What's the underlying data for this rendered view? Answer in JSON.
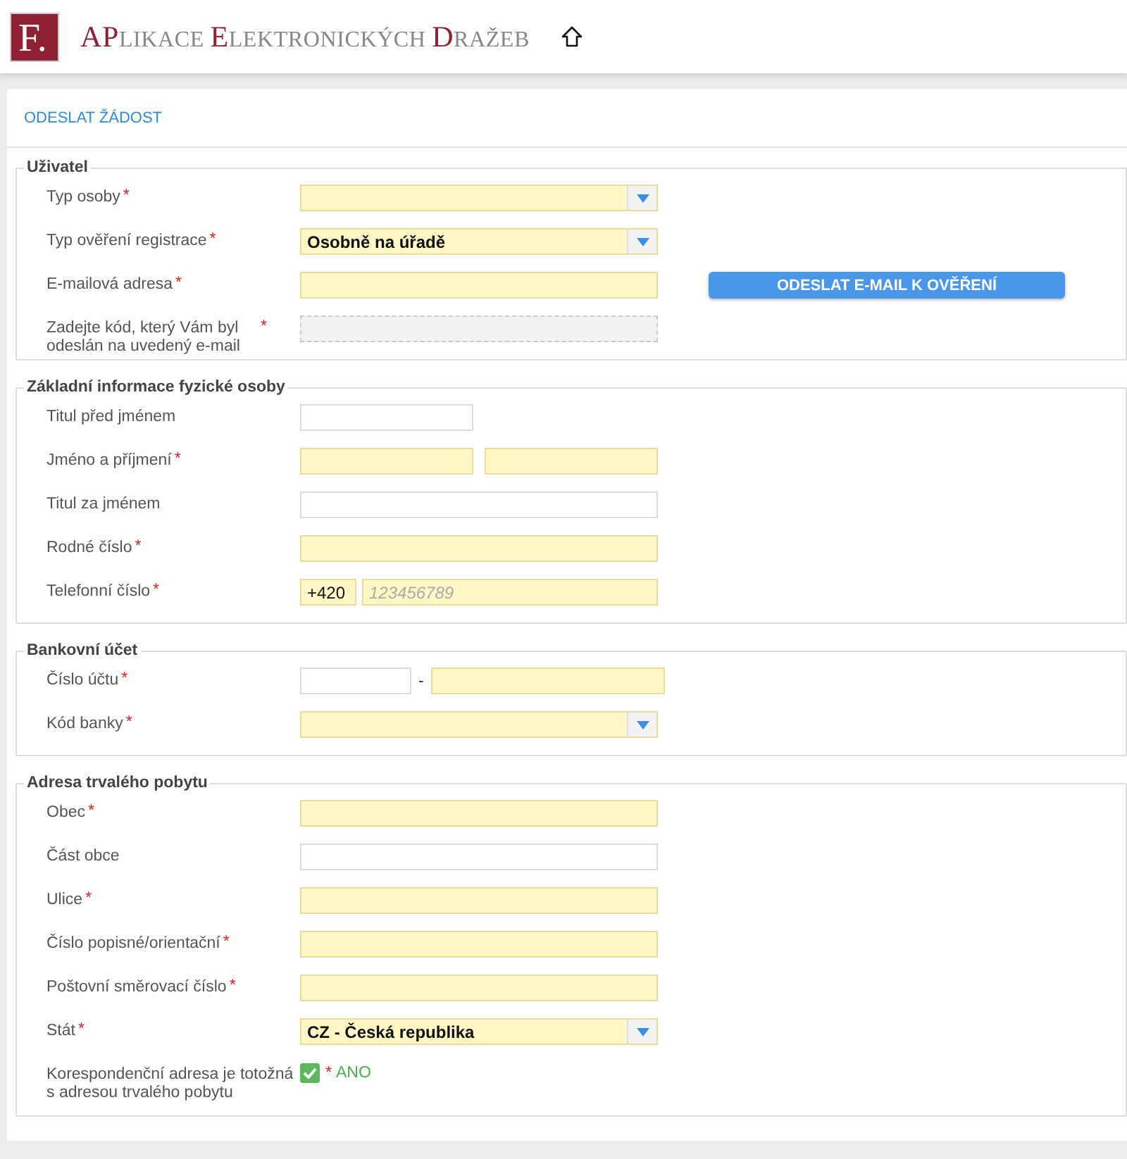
{
  "header": {
    "logo": "F.",
    "title": [
      {
        "text": "AP",
        "accent": true,
        "big": true
      },
      {
        "text": "LIKACE ",
        "accent": false,
        "big": false
      },
      {
        "text": "E",
        "accent": true,
        "big": true
      },
      {
        "text": "LEKTRONICKÝCH ",
        "accent": false,
        "big": false
      },
      {
        "text": "D",
        "accent": true,
        "big": true
      },
      {
        "text": "RAŽEB",
        "accent": false,
        "big": false
      }
    ]
  },
  "card": {
    "title": "ODESLAT ŽÁDOST"
  },
  "sections": [
    {
      "legend": "Uživatel",
      "rows": [
        {
          "kind": "select",
          "label": "Typ osoby",
          "mark": "*"
        },
        {
          "kind": "select",
          "label": "Typ ověření registrace",
          "mark": "*",
          "value": "Osobně na úřadě"
        },
        {
          "kind": "text_button",
          "label": "E-mailová adresa",
          "mark": "*",
          "button": "ODESLAT E-MAIL K OVĚŘENÍ"
        },
        {
          "kind": "readonly",
          "label": "Zadejte kód, který Vám byl odeslán na uvedený e-mail",
          "mark": "*"
        }
      ]
    },
    {
      "legend": "Základní informace fyzické osoby",
      "rows": [
        {
          "kind": "short_text",
          "label": "Titul před jménem"
        },
        {
          "kind": "pair",
          "label": "Jméno a příjmení",
          "mark": "*"
        },
        {
          "kind": "text",
          "label": "Titul za jménem"
        },
        {
          "kind": "text",
          "label": "Rodné číslo",
          "mark": "*"
        },
        {
          "kind": "phone",
          "label": "Telefonní číslo",
          "mark": "*",
          "prefix": "+420",
          "placeholder": "123456789"
        }
      ]
    },
    {
      "legend": "Bankovní účet",
      "rows": [
        {
          "kind": "account",
          "label": "Číslo účtu",
          "mark": "*",
          "separator": "-"
        },
        {
          "kind": "select",
          "label": "Kód banky",
          "mark": "*"
        }
      ]
    },
    {
      "legend": "Adresa trvalého pobytu",
      "rows": [
        {
          "kind": "text",
          "label": "Obec",
          "mark": "*"
        },
        {
          "kind": "text",
          "label": "Část obce"
        },
        {
          "kind": "text",
          "label": "Ulice",
          "mark": "*"
        },
        {
          "kind": "text",
          "label": "Číslo popisné/orientační",
          "mark": "*"
        },
        {
          "kind": "text",
          "label": "Poštovní směrovací číslo",
          "mark": "*"
        },
        {
          "kind": "select",
          "label": "Stát",
          "mark": "*",
          "value": "CZ - Česká republika"
        },
        {
          "kind": "checkbox",
          "label": "Korespondenční adresa je totožná s adresou trvalého pobytu",
          "checked": true,
          "mark": "*",
          "text": "ANO"
        }
      ]
    }
  ]
}
